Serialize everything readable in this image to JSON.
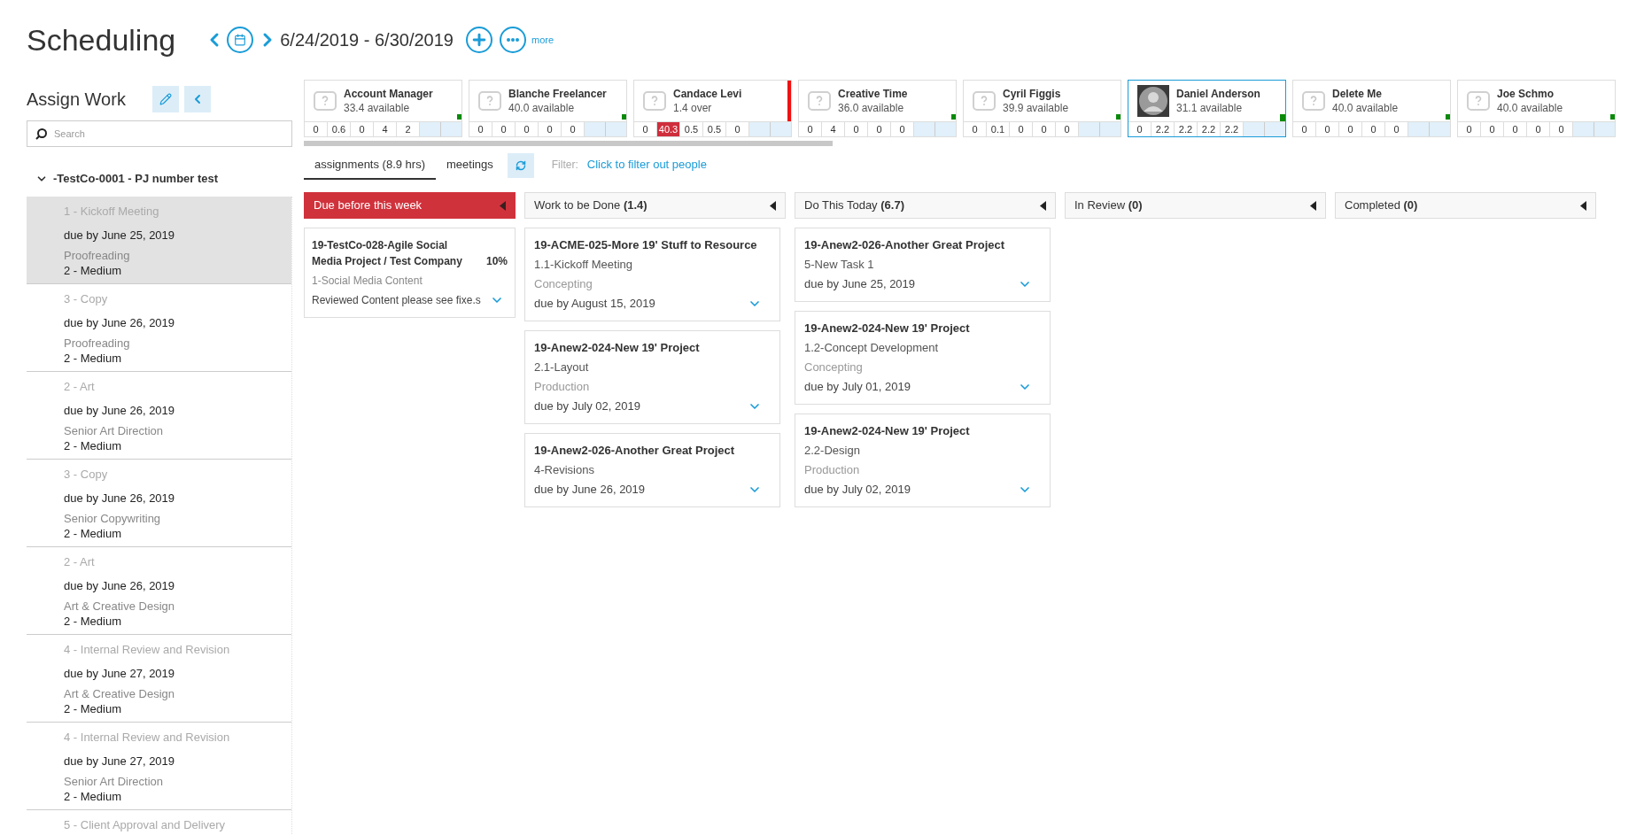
{
  "header": {
    "title": "Scheduling",
    "date_range": "6/24/2019 - 6/30/2019",
    "more_link": "more"
  },
  "sidebar": {
    "title": "Assign Work",
    "search": {
      "placeholder": "Search"
    },
    "group": {
      "label": "-TestCo-0001 - PJ number test",
      "expanded": true,
      "items": [
        {
          "phase": "1 - Kickoff Meeting",
          "due": "due by June 25, 2019",
          "role": "Proofreading",
          "priority": "2 - Medium",
          "selected": true
        },
        {
          "phase": "3 - Copy",
          "due": "due by June 26, 2019",
          "role": "Proofreading",
          "priority": "2 - Medium",
          "selected": false
        },
        {
          "phase": "2 - Art",
          "due": "due by June 26, 2019",
          "role": "Senior Art Direction",
          "priority": "2 - Medium",
          "selected": false
        },
        {
          "phase": "3 - Copy",
          "due": "due by June 26, 2019",
          "role": "Senior Copywriting",
          "priority": "2 - Medium",
          "selected": false
        },
        {
          "phase": "2 - Art",
          "due": "due by June 26, 2019",
          "role": "Art & Creative Design",
          "priority": "2 - Medium",
          "selected": false
        },
        {
          "phase": "4 - Internal Review and Revision",
          "due": "due by June 27, 2019",
          "role": "Art & Creative Design",
          "priority": "2 - Medium",
          "selected": false
        },
        {
          "phase": "4 - Internal Review and Revision",
          "due": "due by June 27, 2019",
          "role": "Senior Art Direction",
          "priority": "2 - Medium",
          "selected": false
        },
        {
          "phase": "5 - Client Approval and Delivery",
          "selected": false
        }
      ]
    }
  },
  "people": [
    {
      "name": "Account Manager",
      "availability": "33.4 available",
      "kind": "placeholder",
      "over": false,
      "selected": false,
      "hours": [
        {
          "value": "0",
          "over": false
        },
        {
          "value": "0.6",
          "over": false
        },
        {
          "value": "0",
          "over": false
        },
        {
          "value": "4",
          "over": false
        },
        {
          "value": "2",
          "over": false
        }
      ]
    },
    {
      "name": "Blanche Freelancer",
      "availability": "40.0 available",
      "kind": "placeholder",
      "over": false,
      "selected": false,
      "hours": [
        {
          "value": "0",
          "over": false
        },
        {
          "value": "0",
          "over": false
        },
        {
          "value": "0",
          "over": false
        },
        {
          "value": "0",
          "over": false
        },
        {
          "value": "0",
          "over": false
        }
      ]
    },
    {
      "name": "Candace Levi",
      "availability": "1.4 over",
      "kind": "placeholder",
      "over": true,
      "selected": false,
      "hours": [
        {
          "value": "0",
          "over": false
        },
        {
          "value": "40.3",
          "over": true
        },
        {
          "value": "0.5",
          "over": false
        },
        {
          "value": "0.5",
          "over": false
        },
        {
          "value": "0",
          "over": false
        }
      ]
    },
    {
      "name": "Creative Time",
      "availability": "36.0 available",
      "kind": "placeholder",
      "over": false,
      "selected": false,
      "hours": [
        {
          "value": "0",
          "over": false
        },
        {
          "value": "4",
          "over": false
        },
        {
          "value": "0",
          "over": false
        },
        {
          "value": "0",
          "over": false
        },
        {
          "value": "0",
          "over": false
        }
      ]
    },
    {
      "name": "Cyril Figgis",
      "availability": "39.9 available",
      "kind": "placeholder",
      "over": false,
      "selected": false,
      "hours": [
        {
          "value": "0",
          "over": false
        },
        {
          "value": "0.1",
          "over": false
        },
        {
          "value": "0",
          "over": false
        },
        {
          "value": "0",
          "over": false
        },
        {
          "value": "0",
          "over": false
        }
      ]
    },
    {
      "name": "Daniel Anderson",
      "availability": "31.1 available",
      "kind": "photo",
      "over": false,
      "selected": true,
      "hours": [
        {
          "value": "0",
          "over": false
        },
        {
          "value": "2.2",
          "over": false
        },
        {
          "value": "2.2",
          "over": false
        },
        {
          "value": "2.2",
          "over": false
        },
        {
          "value": "2.2",
          "over": false
        }
      ]
    },
    {
      "name": "Delete Me",
      "availability": "40.0 available",
      "kind": "placeholder",
      "over": false,
      "selected": false,
      "hours": [
        {
          "value": "0",
          "over": false
        },
        {
          "value": "0",
          "over": false
        },
        {
          "value": "0",
          "over": false
        },
        {
          "value": "0",
          "over": false
        },
        {
          "value": "0",
          "over": false
        }
      ]
    },
    {
      "name": "Joe Schmo",
      "availability": "40.0 available",
      "kind": "placeholder",
      "over": false,
      "selected": false,
      "hours": [
        {
          "value": "0",
          "over": false
        },
        {
          "value": "0",
          "over": false
        },
        {
          "value": "0",
          "over": false
        },
        {
          "value": "0",
          "over": false
        },
        {
          "value": "0",
          "over": false
        }
      ]
    }
  ],
  "tabs": [
    {
      "label": "assignments (8.9 hrs)",
      "selected": true
    },
    {
      "label": "meetings",
      "selected": false
    }
  ],
  "filter": {
    "label": "Filter:",
    "link": "Click to filter out people"
  },
  "columns": [
    {
      "title": "Due before this week",
      "alert": true,
      "cards": [
        {
          "title": "19-TestCo-028-Agile Social Media Project / Test Company",
          "percent": "10%",
          "task": "1-Social Media Content",
          "note": "Reviewed Content please see fixe.s"
        }
      ]
    },
    {
      "title": "Work to be Done **(1.4)**",
      "alert": false,
      "cards": [
        {
          "title": "19-ACME-025-More 19' Stuff to Resource",
          "task": "1.1-Kickoff Meeting",
          "role": "Concepting",
          "due": "due by August 15, 2019"
        },
        {
          "title": "19-Anew2-024-New 19' Project",
          "task": "2.1-Layout",
          "role": "Production",
          "due": "due by July 02, 2019"
        },
        {
          "title": "19-Anew2-026-Another Great Project",
          "task": "4-Revisions",
          "due": "due by June 26, 2019"
        }
      ]
    },
    {
      "title": "Do This Today **(6.7)**",
      "alert": false,
      "cards": [
        {
          "title": "19-Anew2-026-Another Great Project",
          "task": "5-New Task 1",
          "due": "due by June 25, 2019"
        },
        {
          "title": "19-Anew2-024-New 19' Project",
          "task": "1.2-Concept Development",
          "role": "Concepting",
          "due": "due by July 01, 2019"
        },
        {
          "title": "19-Anew2-024-New 19' Project",
          "task": "2.2-Design",
          "role": "Production",
          "due": "due by July 02, 2019"
        }
      ]
    },
    {
      "title": "In Review **(0)**",
      "alert": false
    },
    {
      "title": "Completed **(0)**",
      "alert": false
    }
  ]
}
